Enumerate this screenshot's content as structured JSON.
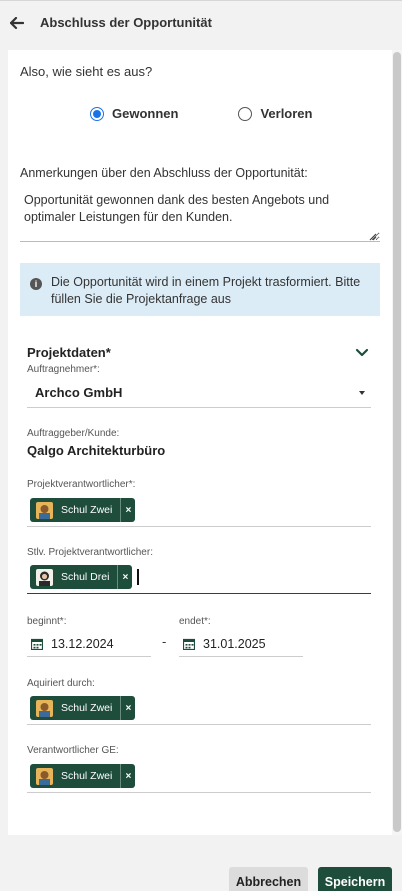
{
  "header": {
    "title": "Abschluss der Opportunität"
  },
  "question": "Also, wie sieht es aus?",
  "outcome": {
    "options": [
      {
        "label": "Gewonnen",
        "checked": true
      },
      {
        "label": "Verloren",
        "checked": false
      }
    ]
  },
  "notes": {
    "label": "Anmerkungen über den Abschluss der Opportunität:",
    "value": "Opportunität gewonnen dank des besten Angebots und optimaler Leistungen für den Kunden."
  },
  "info": {
    "text": "Die Opportunität wird in einem Projekt trasformiert. Bitte füllen Sie die Projektanfrage aus"
  },
  "project": {
    "title": "Projektdaten*",
    "contractor": {
      "label": "Auftragnehmer*:",
      "value": "Archco GmbH"
    },
    "client": {
      "label": "Auftraggeber/Kunde:",
      "value": "Qalgo Architekturbüro"
    },
    "manager": {
      "label": "Projektverantwortlicher*:",
      "chip": "Schul Zwei"
    },
    "deputy": {
      "label": "Stlv. Projektverantwortlicher:",
      "chip": "Schul Drei"
    },
    "start": {
      "label": "beginnt*:",
      "value": "13.12.2024"
    },
    "end": {
      "label": "endet*:",
      "value": "31.01.2025"
    },
    "date_separator": "-",
    "acquired": {
      "label": "Aquiriert durch:",
      "chip": "Schul Zwei"
    },
    "responsible_ge": {
      "label": "Verantwortlicher GE:",
      "chip": "Schul Zwei"
    }
  },
  "footer": {
    "cancel_label": "Abbrechen",
    "save_label": "Speichern"
  },
  "icons": {
    "back": "arrow-left-icon",
    "info": "info-icon",
    "chevron": "chevron-down-icon",
    "calendar": "calendar-icon",
    "remove": "close-icon"
  },
  "colors": {
    "primary": "#1e4d3c",
    "radio": "#1a73e8",
    "info_bg": "#dcecf6"
  },
  "chip_remove_symbol": "×",
  "info_symbol": "i"
}
